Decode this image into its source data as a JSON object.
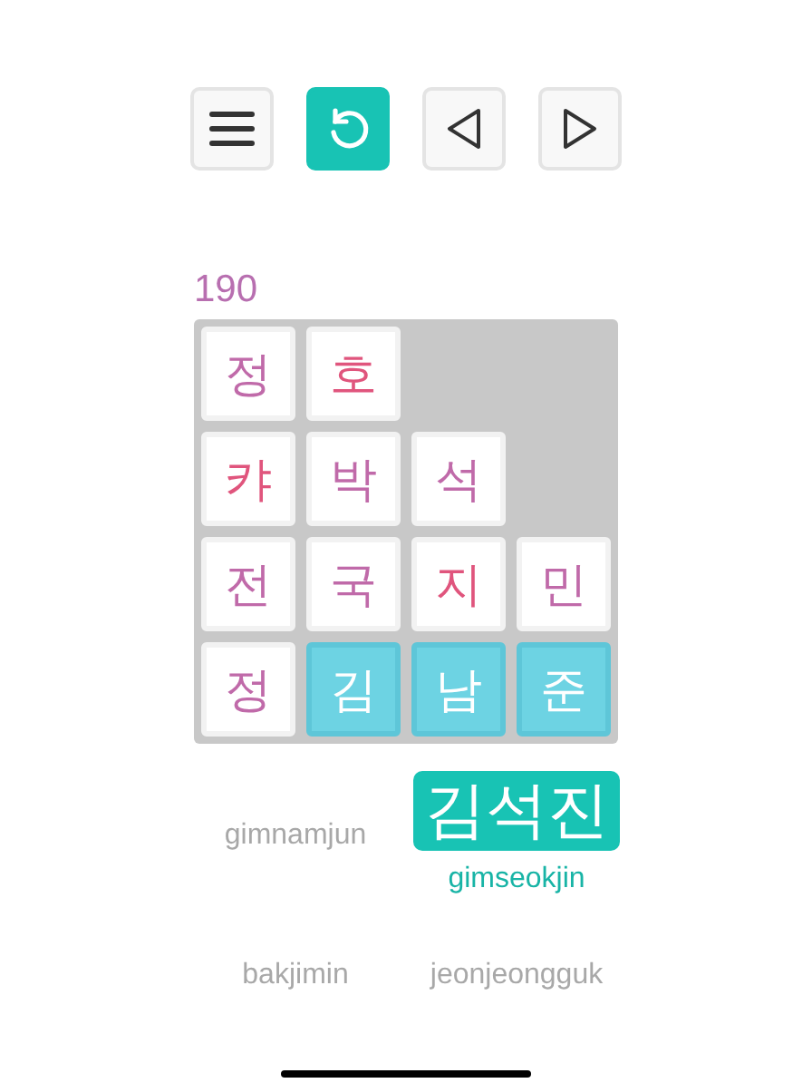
{
  "toolbar": [
    {
      "kind": "menu",
      "selected": false
    },
    {
      "kind": "undo",
      "selected": true
    },
    {
      "kind": "prev",
      "selected": false
    },
    {
      "kind": "next",
      "selected": false
    }
  ],
  "score": "190",
  "board": [
    [
      {
        "char": "정",
        "color": "#c06aa9",
        "selected": false
      },
      {
        "char": "호",
        "color": "#e0557d",
        "selected": false
      }
    ],
    [
      {
        "char": "캬",
        "color": "#e0557d",
        "selected": false
      },
      {
        "char": "박",
        "color": "#c06aa9",
        "selected": false
      },
      {
        "char": "석",
        "color": "#c06aa9",
        "selected": false
      }
    ],
    [
      {
        "char": "전",
        "color": "#c06aa9",
        "selected": false
      },
      {
        "char": "국",
        "color": "#c06aa9",
        "selected": false
      },
      {
        "char": "지",
        "color": "#e0557d",
        "selected": false
      },
      {
        "char": "민",
        "color": "#c06aa9",
        "selected": false
      }
    ],
    [
      {
        "char": "정",
        "color": "#c06aa9",
        "selected": false
      },
      {
        "char": "김",
        "selected": true
      },
      {
        "char": "남",
        "selected": true
      },
      {
        "char": "준",
        "selected": true
      }
    ]
  ],
  "word_rows": [
    [
      {
        "romanization": "gimnamjun",
        "found": false
      },
      {
        "hangul": "김석진",
        "romanization": "gimseokjin",
        "found": true
      }
    ],
    [
      {
        "romanization": "bakjimin",
        "found": false
      },
      {
        "romanization": "jeonjeongguk",
        "found": false
      }
    ]
  ]
}
